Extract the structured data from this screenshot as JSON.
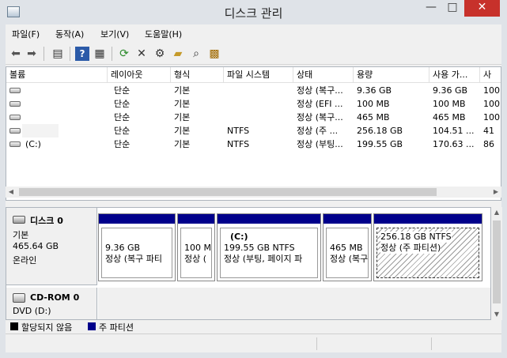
{
  "window": {
    "title": "디스크 관리",
    "min": "—",
    "max": "□",
    "close": "✕"
  },
  "menu": [
    "파일(F)",
    "동작(A)",
    "보기(V)",
    "도움말(H)"
  ],
  "toolbar_icons": [
    "back-arrow",
    "forward-arrow",
    "console-view",
    "help",
    "properties",
    "refresh",
    "delete",
    "settings",
    "open-folder",
    "search-drive",
    "disk-properties"
  ],
  "columns": [
    "볼륨",
    "레이아웃",
    "형식",
    "파일 시스템",
    "상태",
    "용량",
    "사용 가...",
    "사"
  ],
  "volumes": [
    {
      "name": "",
      "layout": "단순",
      "type": "기본",
      "fs": "",
      "status": "정상 (복구...",
      "capacity": "9.36 GB",
      "free": "9.36 GB",
      "pct": "100"
    },
    {
      "name": "",
      "layout": "단순",
      "type": "기본",
      "fs": "",
      "status": "정상 (EFI ...",
      "capacity": "100 MB",
      "free": "100 MB",
      "pct": "100"
    },
    {
      "name": "",
      "layout": "단순",
      "type": "기본",
      "fs": "",
      "status": "정상 (복구...",
      "capacity": "465 MB",
      "free": "465 MB",
      "pct": "100"
    },
    {
      "name": "",
      "layout": "단순",
      "type": "기본",
      "fs": "NTFS",
      "status": "정상 (주 ...",
      "capacity": "256.18 GB",
      "free": "104.51 ...",
      "pct": "41"
    },
    {
      "name": "(C:)",
      "layout": "단순",
      "type": "기본",
      "fs": "NTFS",
      "status": "정상 (부팅...",
      "capacity": "199.55 GB",
      "free": "170.63 ...",
      "pct": "86"
    }
  ],
  "disk0": {
    "name": "디스크 0",
    "kind": "기본",
    "size": "465.64 GB",
    "state": "온라인",
    "partitions": [
      {
        "title": "",
        "size": "9.36 GB",
        "status": "정상 (복구 파티"
      },
      {
        "title": "",
        "size": "100 M",
        "status": "정상 ("
      },
      {
        "title": "(C:)",
        "size": "199.55 GB NTFS",
        "status": "정상 (부팅, 페이지 파"
      },
      {
        "title": "",
        "size": "465 MB",
        "status": "정상 (복구"
      },
      {
        "title": "",
        "size": "256.18 GB NTFS",
        "status": "정상 (주 파티션)"
      }
    ]
  },
  "cdrom": {
    "name": "CD-ROM 0",
    "drive": "DVD (D:)"
  },
  "legend": [
    {
      "label": "할당되지 않음",
      "color": "#000000"
    },
    {
      "label": "주 파티션",
      "color": "#00008b"
    }
  ]
}
